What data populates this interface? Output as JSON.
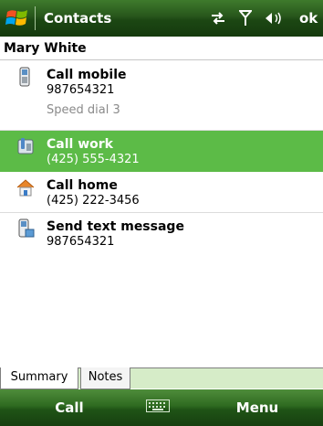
{
  "titlebar": {
    "app_title": "Contacts",
    "ok_label": "ok",
    "icons": [
      "windows-start-icon",
      "connectivity-icon",
      "signal-icon",
      "volume-icon"
    ]
  },
  "contact": {
    "name": "Mary White"
  },
  "actions": [
    {
      "label": "Call mobile",
      "value": "987654321",
      "extra": "Speed dial 3",
      "icon": "mobile-phone-icon"
    },
    {
      "label": "Call work",
      "value": "(425) 555-4321",
      "icon": "work-phone-icon",
      "selected": true
    },
    {
      "label": "Call home",
      "value": "(425) 222-3456",
      "icon": "home-icon"
    },
    {
      "label": "Send text message",
      "value": "987654321",
      "icon": "text-message-icon"
    }
  ],
  "tabs": {
    "summary": "Summary",
    "notes": "Notes",
    "active": "Summary"
  },
  "softkeys": {
    "left": "Call",
    "right": "Menu",
    "middle_icon": "keyboard-icon"
  },
  "colors": {
    "titlebar": "#27561b",
    "selection": "#5cbb47",
    "tabbar": "#d6ecc8"
  }
}
